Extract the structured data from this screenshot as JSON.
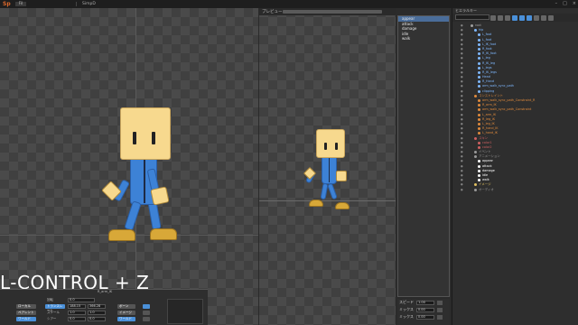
{
  "menubar": {
    "logo": "Sp",
    "items": [
      "Fil",
      "",
      "",
      "",
      ""
    ],
    "project_tab": "SimpD"
  },
  "preview": {
    "title": "プレビュー"
  },
  "hierarchy": {
    "title": "ヒエラルキー"
  },
  "animations": {
    "items": [
      "appear",
      "attack",
      "damage",
      "idle",
      "walk"
    ],
    "selected": "appear"
  },
  "speed": {
    "rows": [
      {
        "label": "スピード",
        "value": "1.00"
      },
      {
        "label": "ミックス",
        "value": "0.00"
      },
      {
        "label": "ミックス",
        "value": "0.00"
      }
    ]
  },
  "tree": [
    {
      "label": "root",
      "indent": 6,
      "color": "#a0a0a0"
    },
    {
      "label": "hip",
      "indent": 8,
      "color": "#7fb8ff"
    },
    {
      "label": "L_foot",
      "indent": 10,
      "color": "#7fb8ff"
    },
    {
      "label": "L_foot",
      "indent": 10,
      "color": "#7fb8ff"
    },
    {
      "label": "L_IK_foot",
      "indent": 10,
      "color": "#7fb8ff"
    },
    {
      "label": "R_foot",
      "indent": 10,
      "color": "#7fb8ff"
    },
    {
      "label": "R_IK_foot",
      "indent": 10,
      "color": "#7fb8ff"
    },
    {
      "label": "L_leg",
      "indent": 10,
      "color": "#7fb8ff"
    },
    {
      "label": "R_IK_leg",
      "indent": 10,
      "color": "#7fb8ff"
    },
    {
      "label": "L_legs",
      "indent": 10,
      "color": "#7fb8ff"
    },
    {
      "label": "R_IK_legs",
      "indent": 10,
      "color": "#7fb8ff"
    },
    {
      "label": "Head",
      "indent": 10,
      "color": "#7fb8ff"
    },
    {
      "label": "R_Hand",
      "indent": 10,
      "color": "#7fb8ff"
    },
    {
      "label": "arm_walk_sync_path",
      "indent": 10,
      "color": "#7fb8ff"
    },
    {
      "label": "clipping",
      "indent": 10,
      "color": "#7fb8ff"
    },
    {
      "label": "コンストレイント",
      "indent": 8,
      "color": "#e08a3c"
    },
    {
      "label": "arm_walk_sync_path_Constraint_R",
      "indent": 10,
      "color": "#e08a3c"
    },
    {
      "label": "R_arm_IK",
      "indent": 10,
      "color": "#e08a3c"
    },
    {
      "label": "arm_walk_sync_path_Constraint",
      "indent": 10,
      "color": "#e08a3c"
    },
    {
      "label": "L_arm_IK",
      "indent": 10,
      "color": "#e08a3c"
    },
    {
      "label": "R_leg_IK",
      "indent": 10,
      "color": "#e08a3c"
    },
    {
      "label": "L_leg_IK",
      "indent": 10,
      "color": "#e08a3c"
    },
    {
      "label": "R_hand_IK",
      "indent": 10,
      "color": "#e08a3c"
    },
    {
      "label": "L_hand_IK",
      "indent": 10,
      "color": "#e08a3c"
    },
    {
      "label": "スキン",
      "indent": 8,
      "color": "#d06060"
    },
    {
      "label": "color1",
      "indent": 10,
      "color": "#d06060"
    },
    {
      "label": "color2",
      "indent": 10,
      "color": "#d06060"
    },
    {
      "label": "イベント",
      "indent": 8,
      "color": "#9a9a9a"
    },
    {
      "label": "アニメーション",
      "indent": 8,
      "color": "#9a9a9a"
    },
    {
      "label": "appear",
      "indent": 10,
      "color": "#ffffff"
    },
    {
      "label": "attack",
      "indent": 10,
      "color": "#ffffff"
    },
    {
      "label": "damage",
      "indent": 10,
      "color": "#ffffff"
    },
    {
      "label": "idle",
      "indent": 10,
      "color": "#ffffff"
    },
    {
      "label": "walk",
      "indent": 10,
      "color": "#ffffff"
    },
    {
      "label": "イメージ",
      "indent": 8,
      "color": "#e0c060"
    },
    {
      "label": "オーディオ",
      "indent": 8,
      "color": "#9a9a9a"
    }
  ],
  "transform": {
    "rows": [
      {
        "label": "回転",
        "v1": "0.0",
        "v2": ""
      },
      {
        "label": "トランスレート",
        "v1": "188.15",
        "v2": "366.28"
      },
      {
        "label": "スケール",
        "v1": "1.0",
        "v2": "1.0"
      },
      {
        "label": "シアー",
        "v1": "0.0",
        "v2": "0.0"
      }
    ],
    "left_buttons": [
      "ローカル",
      "ペアレント",
      "ワールド"
    ],
    "right_buttons": [
      "ボーン",
      "イメージ",
      "ワールド"
    ],
    "bone_name": "R_arm_IK"
  },
  "shortcut_overlay": "L-CONTROL + Z"
}
